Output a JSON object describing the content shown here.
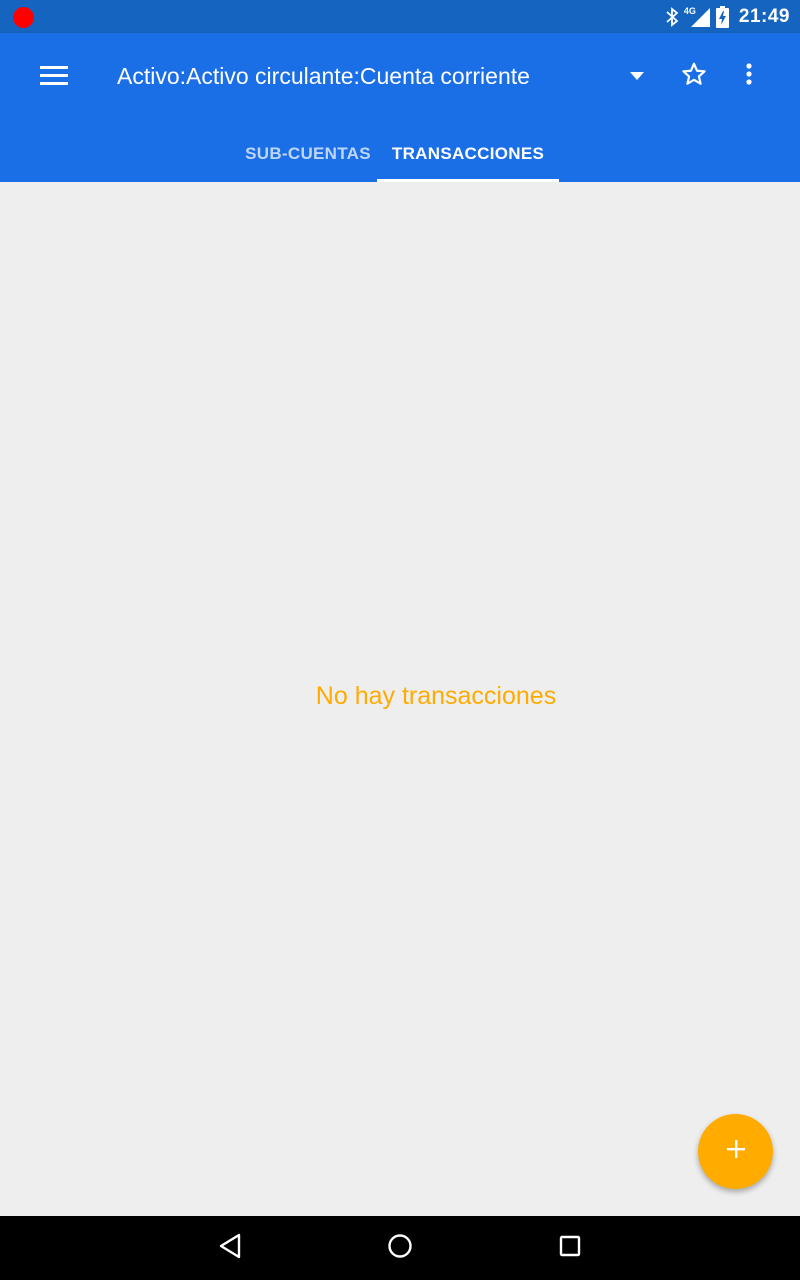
{
  "status_bar": {
    "time": "21:49",
    "network_label": "4G",
    "icons": [
      "recording-dot-icon",
      "bluetooth-icon",
      "signal-4g-icon",
      "battery-charging-icon"
    ],
    "recording_color": "#ff0000"
  },
  "app_bar": {
    "title": "Activo:Activo circulante:Cuenta corriente",
    "menu_icon": "hamburger-menu-icon",
    "dropdown_icon": "dropdown-arrow-icon",
    "star_icon": "star-outline-icon",
    "more_icon": "more-vert-icon",
    "color": "#1a6ee6"
  },
  "tabs": [
    {
      "label": "SUB-CUENTAS",
      "selected": false
    },
    {
      "label": "TRANSACCIONES",
      "selected": true
    }
  ],
  "content": {
    "empty_message": "No hay transacciones",
    "empty_message_color": "#ffab00"
  },
  "fab": {
    "icon": "plus-icon",
    "color": "#ffab00"
  },
  "nav_bar": {
    "icons": [
      "back-icon",
      "home-icon",
      "recents-icon"
    ]
  }
}
